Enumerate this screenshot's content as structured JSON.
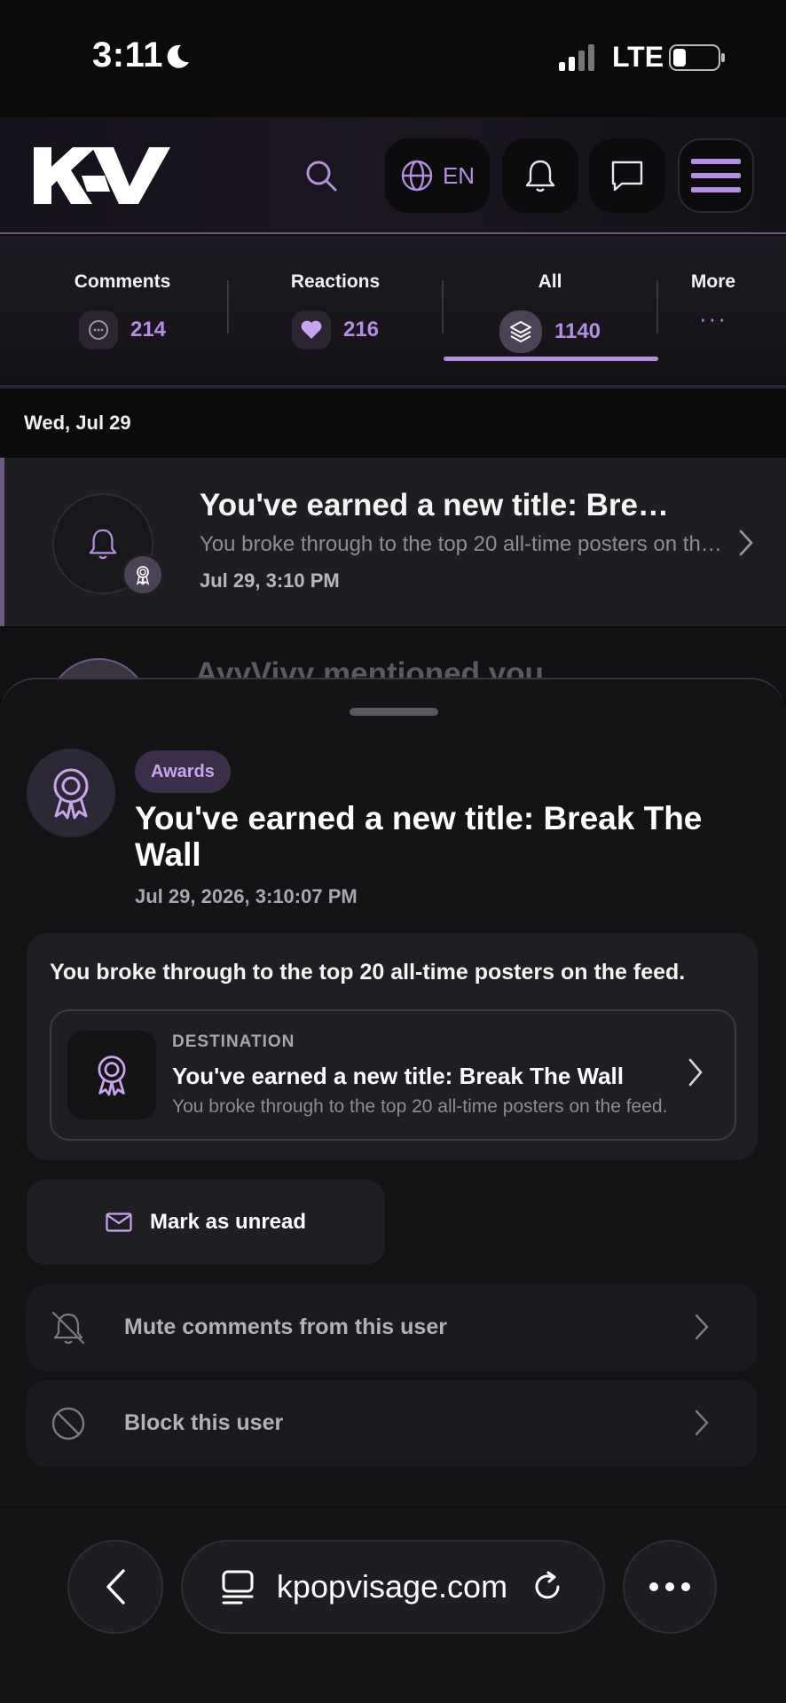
{
  "status_bar": {
    "time": "3:11",
    "network": "LTE"
  },
  "header": {
    "logo_text": "KV",
    "language": "EN"
  },
  "tabs": [
    {
      "label": "Comments",
      "count": "214"
    },
    {
      "label": "Reactions",
      "count": "216"
    },
    {
      "label": "All",
      "count": "1140",
      "active": true
    },
    {
      "label": "More",
      "count": "···"
    }
  ],
  "date_header": "Wed, Jul 29",
  "notification": {
    "title": "You've earned a new title: Bre…",
    "body": "You broke through to the top 20 all-time posters on th…",
    "time": "Jul 29, 3:10 PM"
  },
  "notification_next": {
    "title": "AyyVivy mentioned you"
  },
  "sheet": {
    "category": "Awards",
    "title": "You've earned a new title: Break The Wall",
    "timestamp": "Jul 29, 2026, 3:10:07 PM",
    "message": "You broke through to the top 20 all-time posters on the feed.",
    "destination": {
      "label": "DESTINATION",
      "title": "You've earned a new title: Break The Wall",
      "body": "You broke through to the top 20 all-time posters on the feed."
    },
    "mark_unread": "Mark as unread",
    "mute": "Mute comments from this user",
    "block": "Block this user"
  },
  "browser": {
    "url": "kpopvisage.com"
  },
  "colors": {
    "accent": "#b48ee0",
    "background": "#0b0b0c",
    "sheet": "#141315"
  }
}
